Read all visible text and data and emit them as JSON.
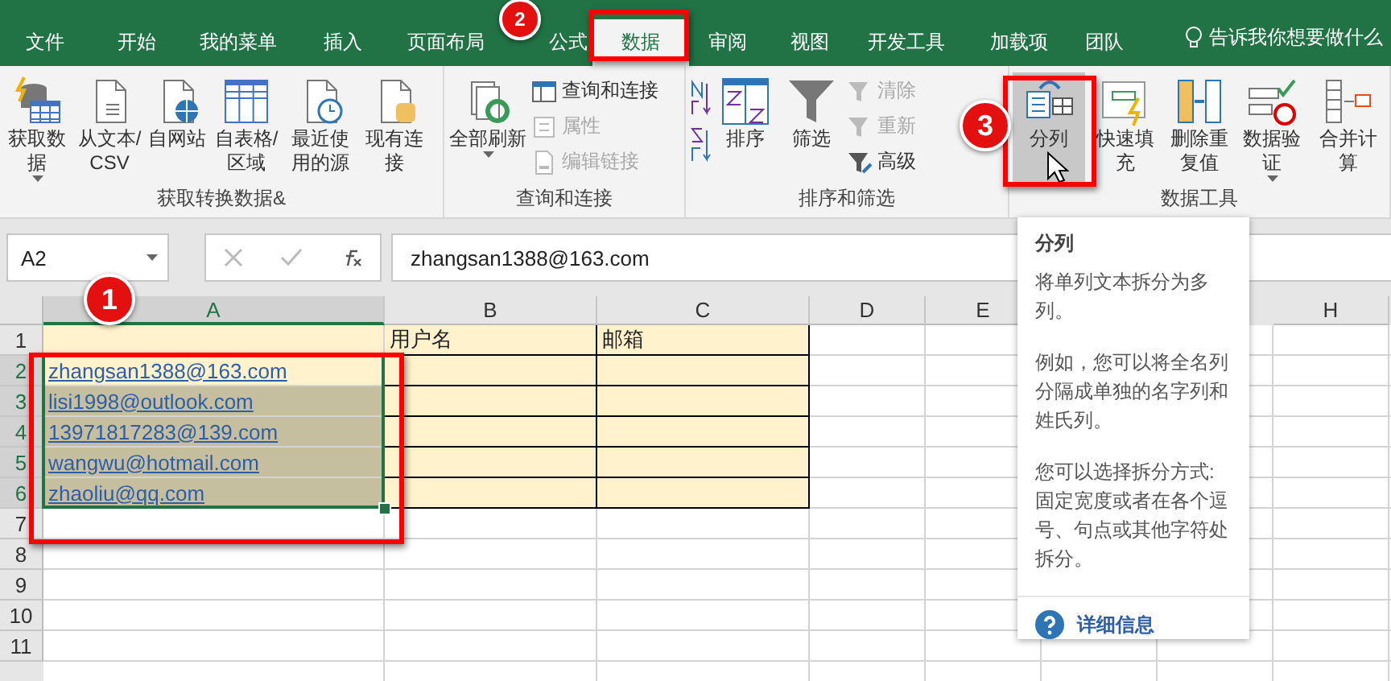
{
  "tabs": [
    {
      "label": "文件",
      "selected": false
    },
    {
      "label": "开始",
      "selected": false
    },
    {
      "label": "我的菜单",
      "selected": false
    },
    {
      "label": "插入",
      "selected": false
    },
    {
      "label": "页面布局",
      "selected": false
    },
    {
      "label": "公式",
      "selected": false
    },
    {
      "label": "数据",
      "selected": true
    },
    {
      "label": "审阅",
      "selected": false
    },
    {
      "label": "视图",
      "selected": false
    },
    {
      "label": "开发工具",
      "selected": false
    },
    {
      "label": "加载项",
      "selected": false
    },
    {
      "label": "团队",
      "selected": false
    }
  ],
  "tell_me": "告诉我你想要做什么",
  "ribbon_groups": [
    {
      "title": "获取转换数据&",
      "buttons": [
        {
          "kind": "large",
          "label": "获取数据",
          "dropdown": true,
          "selected": false
        },
        {
          "kind": "large",
          "label": "从文本/CSV",
          "selected": false
        },
        {
          "kind": "large",
          "label": "自网站",
          "selected": false
        },
        {
          "kind": "large",
          "label": "自表格/区域",
          "selected": false
        },
        {
          "kind": "large",
          "label": "最近使用的源",
          "selected": false
        },
        {
          "kind": "large",
          "label": "现有连接",
          "selected": false
        }
      ]
    },
    {
      "title": "查询和连接",
      "buttons": [
        {
          "kind": "large",
          "label": "全部刷新",
          "dropdown": true,
          "selected": false
        },
        {
          "kind": "small",
          "label": "查询和连接",
          "disabled": false
        },
        {
          "kind": "small",
          "label": "属性",
          "disabled": true
        },
        {
          "kind": "small",
          "label": "编辑链接",
          "disabled": true
        }
      ]
    },
    {
      "title": "排序和筛选",
      "buttons": [
        {
          "kind": "icon"
        },
        {
          "kind": "icon"
        },
        {
          "kind": "large",
          "label": "排序",
          "selected": false
        },
        {
          "kind": "large",
          "label": "筛选",
          "selected": false
        },
        {
          "kind": "small",
          "label": "清除",
          "disabled": true
        },
        {
          "kind": "small",
          "label": "重新",
          "disabled": true
        },
        {
          "kind": "small",
          "label": "高级",
          "disabled": false
        }
      ]
    },
    {
      "title": "数据工具",
      "buttons": [
        {
          "kind": "large",
          "label": "分列",
          "selected": true
        },
        {
          "kind": "large",
          "label": "快速填充",
          "selected": false
        },
        {
          "kind": "large",
          "label": "删除重复值",
          "selected": false
        },
        {
          "kind": "large",
          "label": "数据验证",
          "dropdown": true,
          "selected": false
        },
        {
          "kind": "large",
          "label": "合并计算",
          "selected": false
        }
      ]
    }
  ],
  "name_box": "A2",
  "formula": "zhangsan1388@163.com",
  "columns": [
    {
      "label": "A",
      "selected": true
    },
    {
      "label": "B",
      "selected": false
    },
    {
      "label": "C",
      "selected": false
    },
    {
      "label": "D",
      "selected": false
    },
    {
      "label": "E",
      "selected": false
    },
    {
      "label": "H",
      "selected": false
    }
  ],
  "rows": [
    {
      "label": "1",
      "selected": false,
      "cells": [
        {
          "filled": true,
          "selected": false
        },
        {
          "text": "用户名",
          "filled": true,
          "selected": false
        },
        {
          "text": "邮箱",
          "filled": true,
          "selected": false
        }
      ]
    },
    {
      "label": "2",
      "selected": true,
      "cells": [
        {
          "text": "zhangsan1388@163.com",
          "link": true,
          "filled": true,
          "selected": false
        },
        {
          "filled": true,
          "selected": false
        },
        {
          "filled": true,
          "selected": false
        }
      ]
    },
    {
      "label": "3",
      "selected": true,
      "cells": [
        {
          "text": "lisi1998@outlook.com",
          "link": true,
          "filled": true,
          "selected": true
        },
        {
          "filled": true,
          "selected": false
        },
        {
          "filled": true,
          "selected": false
        }
      ]
    },
    {
      "label": "4",
      "selected": true,
      "cells": [
        {
          "text": "13971817283@139.com",
          "link": true,
          "filled": true,
          "selected": true
        },
        {
          "filled": true,
          "selected": false
        },
        {
          "filled": true,
          "selected": false
        }
      ]
    },
    {
      "label": "5",
      "selected": true,
      "cells": [
        {
          "text": "wangwu@hotmail.com",
          "link": true,
          "filled": true,
          "selected": true
        },
        {
          "filled": true,
          "selected": false
        },
        {
          "filled": true,
          "selected": false
        }
      ]
    },
    {
      "label": "6",
      "selected": true,
      "cells": [
        {
          "text": "zhaoliu@qq.com",
          "link": true,
          "filled": true,
          "selected": true
        },
        {
          "filled": true,
          "selected": false
        },
        {
          "filled": true,
          "selected": false
        }
      ]
    },
    {
      "label": "7",
      "selected": false
    },
    {
      "label": "8",
      "selected": false
    },
    {
      "label": "9",
      "selected": false
    },
    {
      "label": "10",
      "selected": false
    },
    {
      "label": "11",
      "selected": false
    }
  ],
  "tooltip": {
    "title": "分列",
    "paragraphs": [
      "将单列文本拆分为多列。",
      "例如，您可以将全名列分隔成单独的名字列和姓氏列。",
      "您可以选择拆分方式:固定宽度或者在各个逗号、句点或其他字符处拆分。"
    ],
    "link": "详细信息"
  },
  "annotations": [
    "1",
    "2",
    "3"
  ]
}
